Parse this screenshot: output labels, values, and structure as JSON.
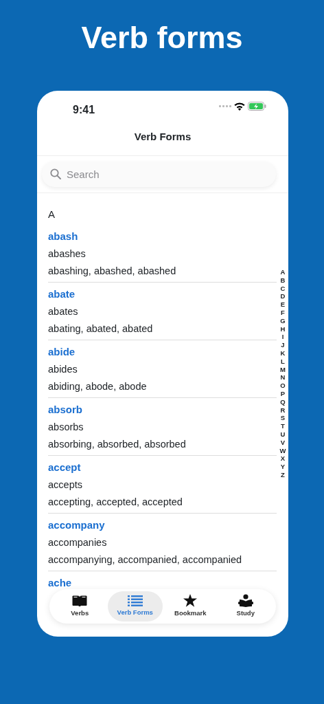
{
  "headline": "Verb forms",
  "status_bar": {
    "time": "9:41"
  },
  "nav": {
    "title": "Verb Forms"
  },
  "search": {
    "placeholder": "Search"
  },
  "sections": [
    {
      "letter": "A",
      "entries": [
        {
          "verb": "abash",
          "third_person": "abashes",
          "forms": "abashing, abashed, abashed"
        },
        {
          "verb": "abate",
          "third_person": "abates",
          "forms": "abating, abated, abated"
        },
        {
          "verb": "abide",
          "third_person": "abides",
          "forms": "abiding, abode, abode"
        },
        {
          "verb": "absorb",
          "third_person": "absorbs",
          "forms": "absorbing, absorbed, absorbed"
        },
        {
          "verb": "accept",
          "third_person": "accepts",
          "forms": "accepting, accepted, accepted"
        },
        {
          "verb": "accompany",
          "third_person": "accompanies",
          "forms": "accompanying, accompanied, accompanied"
        },
        {
          "verb": "ache"
        }
      ]
    }
  ],
  "index": [
    "A",
    "B",
    "C",
    "D",
    "E",
    "F",
    "G",
    "H",
    "I",
    "J",
    "K",
    "L",
    "M",
    "N",
    "O",
    "P",
    "Q",
    "R",
    "S",
    "T",
    "U",
    "V",
    "W",
    "X",
    "Y",
    "Z"
  ],
  "tabs": [
    {
      "label": "Verbs",
      "kind": "book",
      "selected": false
    },
    {
      "label": "Verb Forms",
      "kind": "list",
      "selected": true
    },
    {
      "label": "Bookmark",
      "kind": "star",
      "selected": false
    },
    {
      "label": "Study",
      "kind": "reader",
      "selected": false
    }
  ]
}
